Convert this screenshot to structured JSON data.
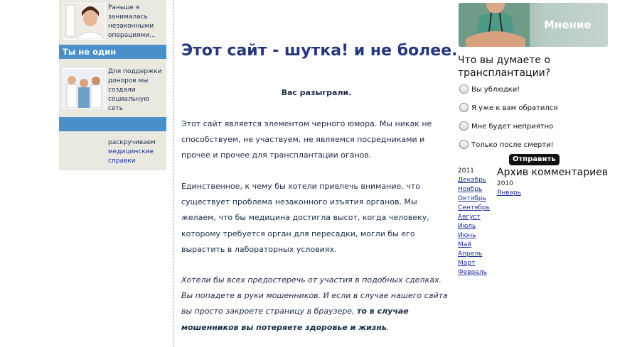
{
  "left": {
    "item1_text": "Раньше я занималась незаконными операциями...",
    "heading": "Ты не один",
    "item2_text": "Для поддержки доноров мы создали социальную сеть",
    "promo_line1": "раскручиваем",
    "promo_line2": "медицинские справки"
  },
  "main": {
    "title": "Этот сайт - шутка! и не более.",
    "subtitle": "Вас разыграли.",
    "para1": "Этот сайт является элементом черного юмора. Мы никак не способствуем, не участвуем, не являемся посредниками и прочее и прочее для трансплантации оганов.",
    "para2": "Единственное, к чему бы хотели привлечь внимание, что существует проблема незаконного изъятия органов. Мы желаем, что бы медицина достигла высот, когда человеку, которому требуется орган для пересадки, могли бы его вырастить в лабораторных условиях.",
    "para3_start": "Хотели бы всех предостеречь от участия в подобных сделках. Вы попадете в руки мошенников. И если в случае нашего сайта вы просто закроете страницу в браузере, ",
    "para3_bold": "то в случае мошенников вы потеряете здоровье и жизнь",
    "para3_end": "."
  },
  "right": {
    "banner_title": "Мнение",
    "poll_question": "Что вы думаете о трансплантации?",
    "poll_options": [
      "Вы ублюдки!",
      "Я уже к вам обратился",
      "Мне будет неприятно",
      "Только после смерти!"
    ],
    "submit_label": "Отправить",
    "archive_title": "Архив комментариев",
    "year_2011": "2011",
    "months_2011": [
      "Декабрь",
      "Ноябрь",
      "Октябрь",
      "Сентябрь",
      "Август",
      "Июль",
      "Июнь",
      "Май",
      "Апрель",
      "Март",
      "Февраль"
    ],
    "year_2010": "2010",
    "months_2010": [
      "Январь"
    ]
  },
  "colors": {
    "accent_bar": "#4a90c8",
    "title": "#27377a",
    "link": "#1d2f9e",
    "sidebar_bg": "#e9e9e1"
  }
}
